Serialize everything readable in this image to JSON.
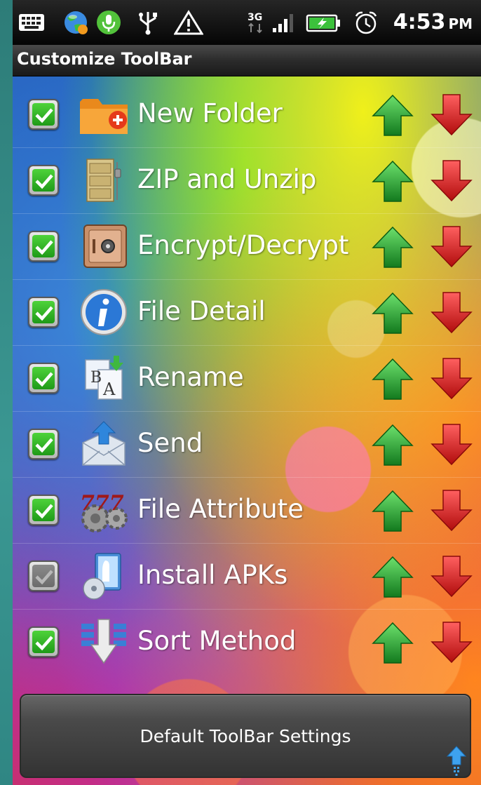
{
  "status_bar": {
    "time": "4:53",
    "ampm": "PM",
    "network": "3G",
    "icons": [
      "keyboard-icon",
      "browser-globe-icon",
      "microphone-icon",
      "usb-icon",
      "warning-icon",
      "network-3g-icon",
      "signal-icon",
      "battery-charging-icon",
      "alarm-icon"
    ]
  },
  "title": "Customize ToolBar",
  "items": [
    {
      "label": "New Folder",
      "checked": true,
      "icon": "new-folder-icon"
    },
    {
      "label": "ZIP and Unzip",
      "checked": true,
      "icon": "zip-cabinet-icon"
    },
    {
      "label": "Encrypt/Decrypt",
      "checked": true,
      "icon": "safe-icon"
    },
    {
      "label": "File Detail",
      "checked": true,
      "icon": "info-icon"
    },
    {
      "label": "Rename",
      "checked": true,
      "icon": "rename-icon"
    },
    {
      "label": "Send",
      "checked": true,
      "icon": "send-mail-icon"
    },
    {
      "label": "File Attribute",
      "checked": true,
      "icon": "attribute-gears-icon"
    },
    {
      "label": "Install APKs",
      "checked": false,
      "icon": "install-apk-icon"
    },
    {
      "label": "Sort Method",
      "checked": true,
      "icon": "sort-icon"
    }
  ],
  "default_button": {
    "label": "Default ToolBar Settings"
  },
  "colors": {
    "check_green": "#1f9a18",
    "arrow_up": "#1e9a2a",
    "arrow_down": "#e01818"
  }
}
